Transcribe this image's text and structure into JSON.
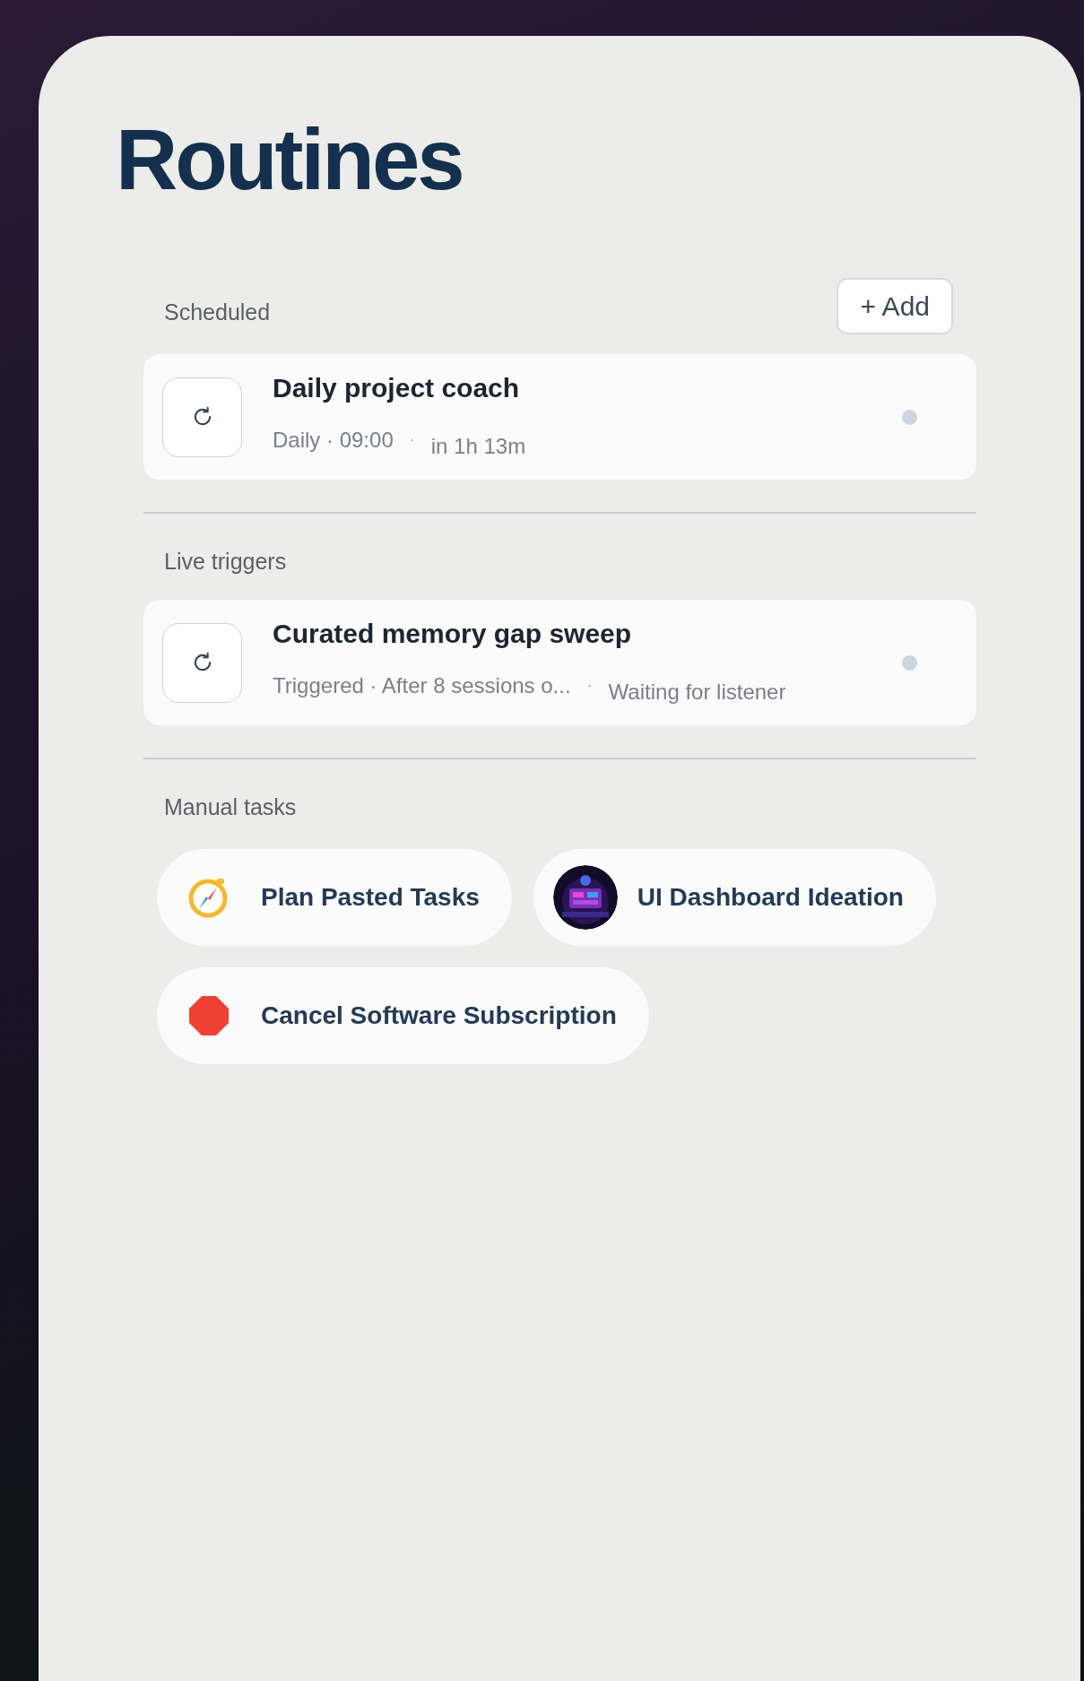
{
  "title": "Routines",
  "add_button": "+ Add",
  "sections": [
    {
      "kind": "routines",
      "label": "Scheduled",
      "items": [
        {
          "name": "Daily project coach",
          "detail": "Daily · 09:00",
          "separator": "·",
          "status": "in 1h 13m",
          "active": false
        }
      ]
    },
    {
      "kind": "routines",
      "label": "Live triggers",
      "items": [
        {
          "name": "Curated memory gap sweep",
          "detail": "Triggered · After 8 sessions o...",
          "separator": "·",
          "status": "Waiting for listener",
          "active": false
        }
      ]
    },
    {
      "kind": "tasks",
      "label": "Manual tasks",
      "items": [
        {
          "name": "Plan Pasted Tasks",
          "kind": "compass"
        },
        {
          "name": "UI Dashboard Ideation",
          "kind": "picture"
        },
        {
          "name": "Cancel Software Subscription",
          "kind": "stop"
        }
      ]
    }
  ]
}
